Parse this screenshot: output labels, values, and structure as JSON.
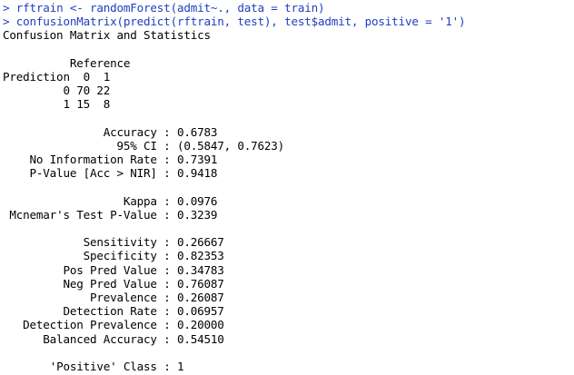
{
  "console": {
    "commands": [
      {
        "prompt": ">",
        "code": "rftrain <- randomForest(admit~., data = train)"
      },
      {
        "prompt": ">",
        "code": "confusionMatrix(predict(rftrain, test), test$admit, positive = '1')"
      }
    ],
    "output": {
      "header": "Confusion Matrix and Statistics",
      "table": {
        "reference_label": "Reference",
        "prediction_label": "Prediction",
        "col_levels": [
          "0",
          "1"
        ],
        "rows": [
          {
            "level": "0",
            "values": [
              "70",
              "22"
            ]
          },
          {
            "level": "1",
            "values": [
              "15",
              "8"
            ]
          }
        ]
      },
      "overall_stats": [
        {
          "label": "Accuracy",
          "value": "0.6783"
        },
        {
          "label": "95% CI",
          "value": "(0.5847, 0.7623)"
        },
        {
          "label": "No Information Rate",
          "value": "0.7391"
        },
        {
          "label": "P-Value [Acc > NIR]",
          "value": "0.9418"
        }
      ],
      "agreement_stats": [
        {
          "label": "Kappa",
          "value": "0.0976"
        },
        {
          "label": "Mcnemar's Test P-Value",
          "value": "0.3239"
        }
      ],
      "class_stats": [
        {
          "label": "Sensitivity",
          "value": "0.26667"
        },
        {
          "label": "Specificity",
          "value": "0.82353"
        },
        {
          "label": "Pos Pred Value",
          "value": "0.34783"
        },
        {
          "label": "Neg Pred Value",
          "value": "0.76087"
        },
        {
          "label": "Prevalence",
          "value": "0.26087"
        },
        {
          "label": "Detection Rate",
          "value": "0.06957"
        },
        {
          "label": "Detection Prevalence",
          "value": "0.20000"
        },
        {
          "label": "Balanced Accuracy",
          "value": "0.54510"
        }
      ],
      "positive_class": {
        "label": "'Positive' Class",
        "value": "1"
      }
    },
    "colors": {
      "command_text": "#1f3fbf",
      "output_text": "#000000",
      "background": "#ffffff"
    }
  }
}
